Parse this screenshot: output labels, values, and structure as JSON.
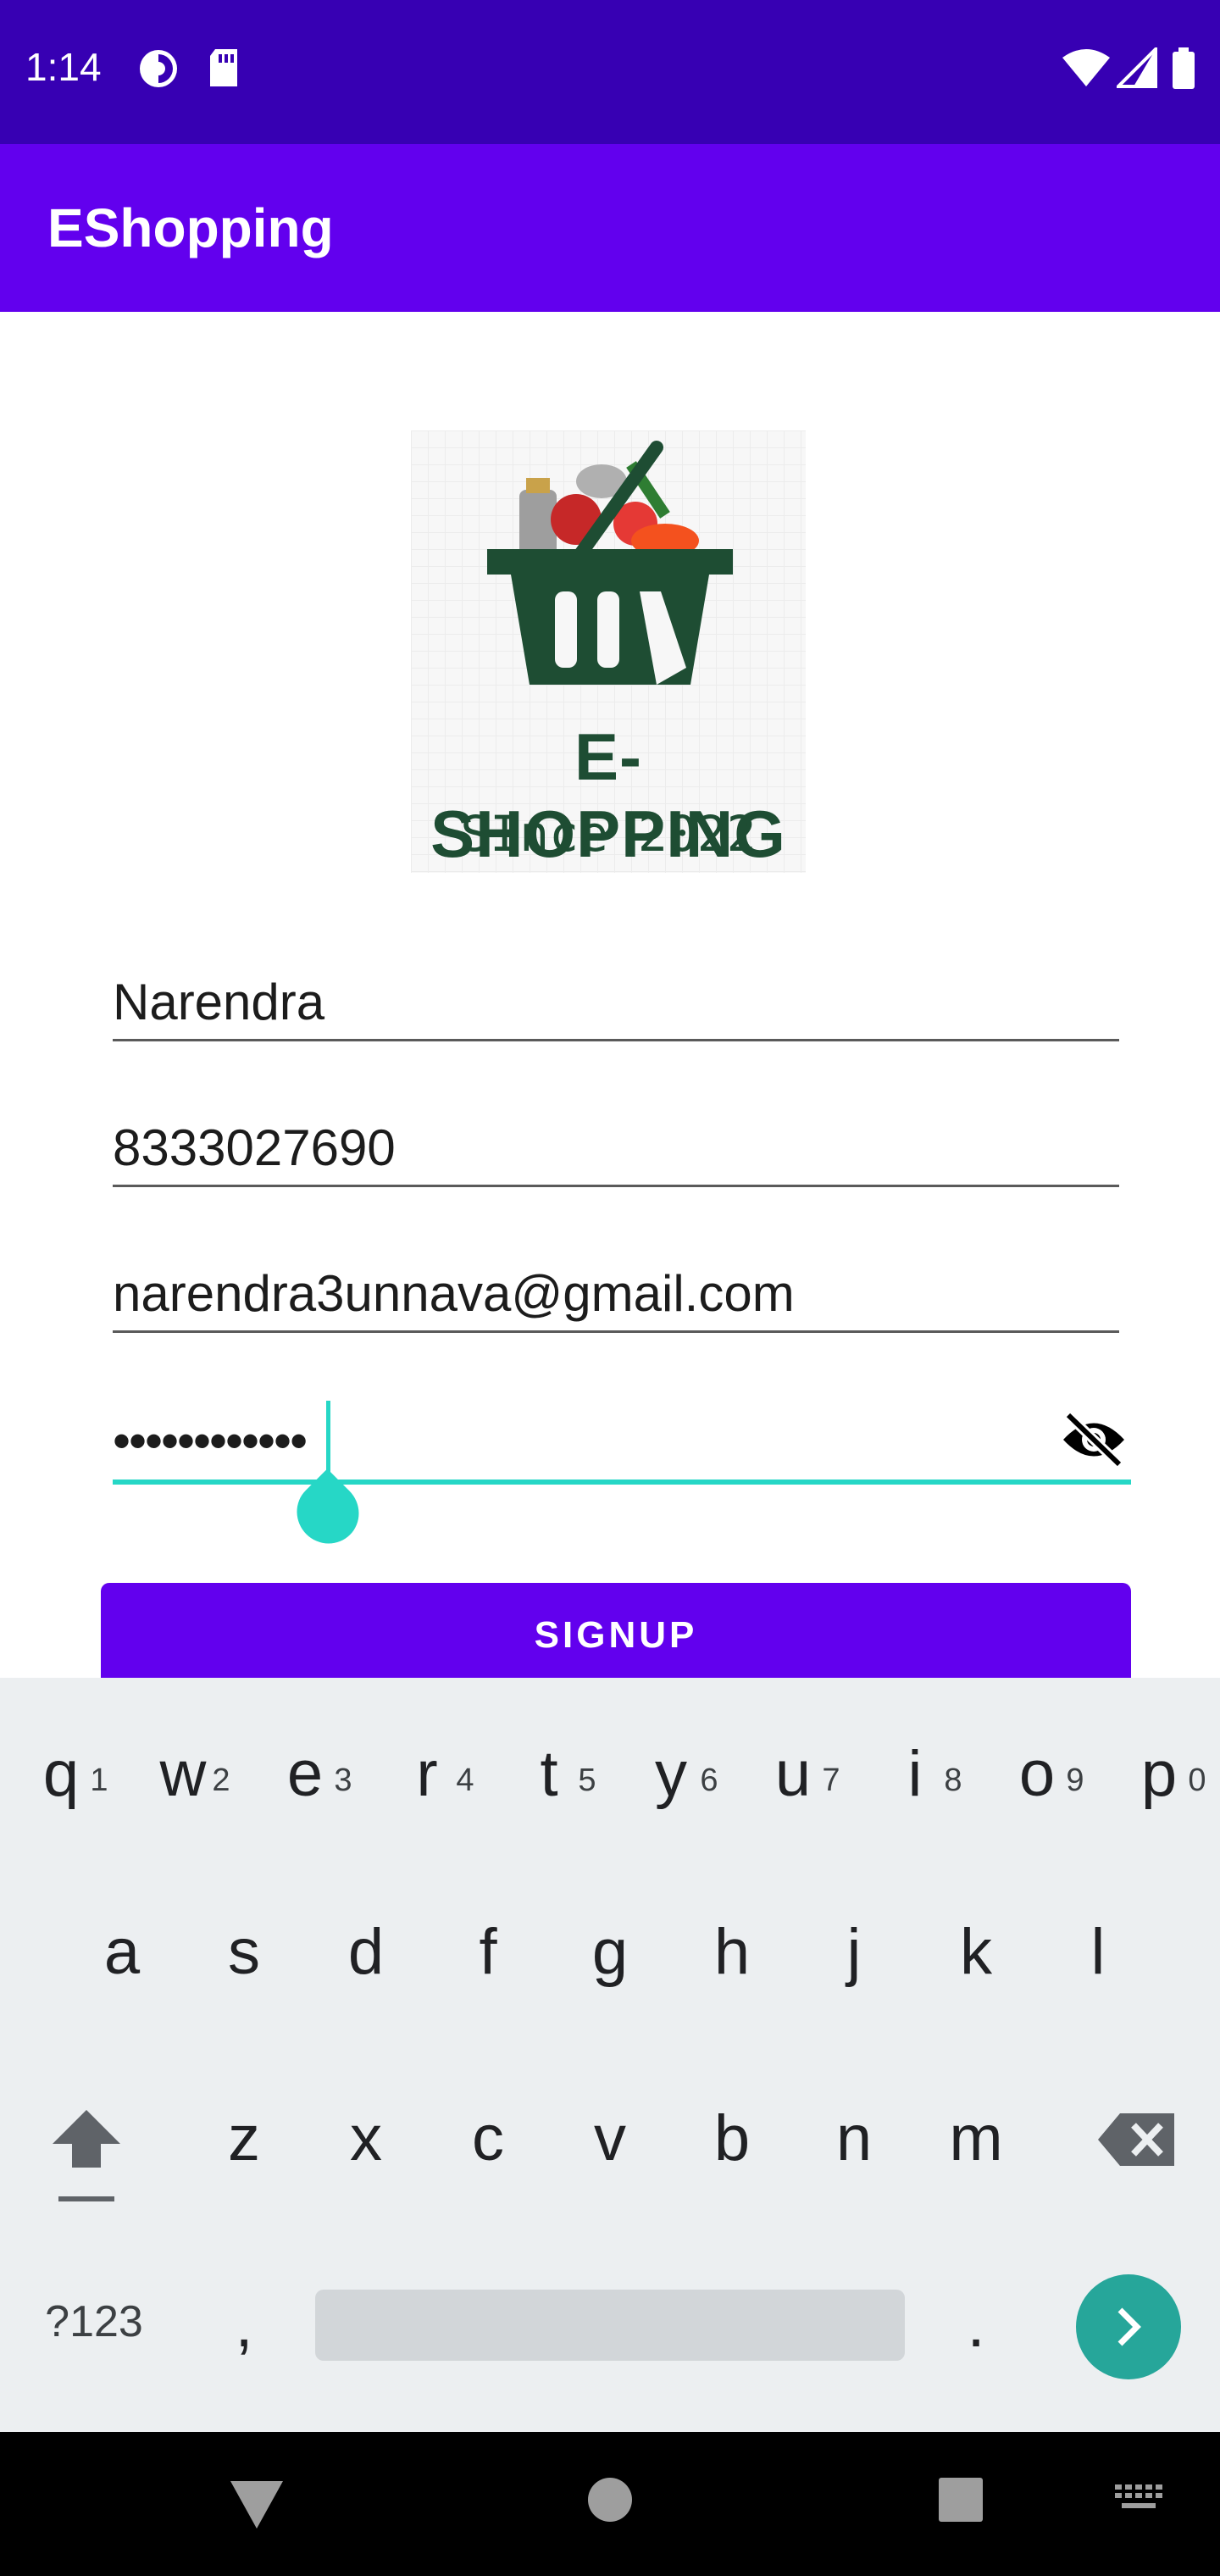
{
  "status_bar": {
    "time": "1:14",
    "icons": [
      "data-saver-icon",
      "sd-card-icon",
      "wifi-icon",
      "cell-signal-icon",
      "battery-icon"
    ]
  },
  "app_bar": {
    "title": "EShopping"
  },
  "logo": {
    "line1": "E-SHOPPING",
    "line2": "SInce 2022",
    "colors": {
      "text": "#1e4d33",
      "basket": "#1e4d33"
    }
  },
  "form": {
    "name": "Narendra",
    "phone": "8333027690",
    "email": "narendra3unnava@gmail.com",
    "password_masked": "••••••••••••",
    "password_toggle_icon": "visibility-off-icon",
    "signup_label": "SIGNUP"
  },
  "keyboard": {
    "row1": [
      {
        "num": "1",
        "key": "q"
      },
      {
        "num": "2",
        "key": "w"
      },
      {
        "num": "3",
        "key": "e"
      },
      {
        "num": "4",
        "key": "r"
      },
      {
        "num": "5",
        "key": "t"
      },
      {
        "num": "6",
        "key": "y"
      },
      {
        "num": "7",
        "key": "u"
      },
      {
        "num": "8",
        "key": "i"
      },
      {
        "num": "9",
        "key": "o"
      },
      {
        "num": "0",
        "key": "p"
      }
    ],
    "row2": [
      "a",
      "s",
      "d",
      "f",
      "g",
      "h",
      "j",
      "k",
      "l"
    ],
    "row3": [
      "z",
      "x",
      "c",
      "v",
      "b",
      "n",
      "m"
    ],
    "symbols_label": "?123",
    "comma": ",",
    "period": ".",
    "accent_color": "#26a69a"
  },
  "colors": {
    "status_bar": "#3700b3",
    "primary": "#6200ee",
    "cursor": "#26d7c6"
  }
}
